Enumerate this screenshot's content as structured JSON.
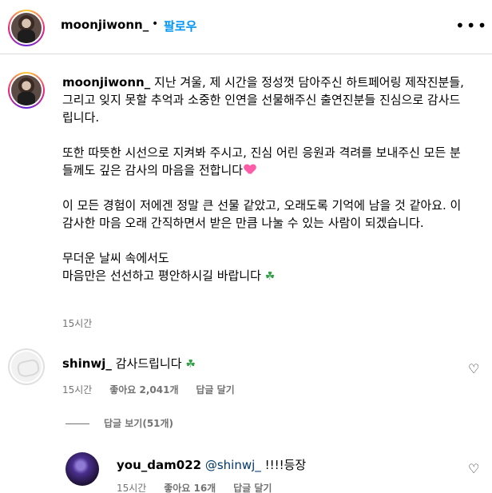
{
  "header": {
    "username": "moonjiwonn_",
    "separator": "•",
    "follow_label": "팔로우",
    "more_icon": "more-horizontal-icon"
  },
  "caption": {
    "username": "moonjiwonn_",
    "paragraphs": [
      "지난 겨울, 제 시간을 정성껏 담아주신 하트페어링 제작진분들, 그리고 잊지 못할 추억과 소중한 인연을 선물해주신 출연진분들 진심으로 감사드립니다.",
      "또한 따뜻한 시선으로 지켜봐 주시고, 진심 어린 응원과 격려를 보내주신 모든 분들께도 깊은 감사의 마음을 전합니다",
      "이 모든 경험이 저에겐 정말 큰 선물 같았고, 오래도록 기억에 남을 것 같아요. 이 감사한 마음 오래 간직하면서 받은 만큼 나눌 수 있는 사람이 되겠습니다.",
      "무더운 날씨 속에서도",
      "마음만은 선선하고 평안하시길 바랍니다"
    ],
    "time": "15시간"
  },
  "comments": [
    {
      "username": "shinwj_",
      "text": "감사드립니다",
      "time": "15시간",
      "likes": "좋아요 2,041개",
      "reply_label": "답글 달기"
    }
  ],
  "view_replies_label": "답글 보기(51개)",
  "replies": [
    {
      "username": "you_dam022",
      "mention": "@shinwj_",
      "text": "!!!!등장",
      "time": "15시간",
      "likes": "좋아요 16개",
      "reply_label": "답글 달기"
    }
  ],
  "colors": {
    "follow_blue": "#0095f6",
    "secondary_text": "#737373",
    "mention": "#00376b",
    "heart_emoji": "#ff5ca8",
    "clover_emoji": "#2f9e44"
  }
}
